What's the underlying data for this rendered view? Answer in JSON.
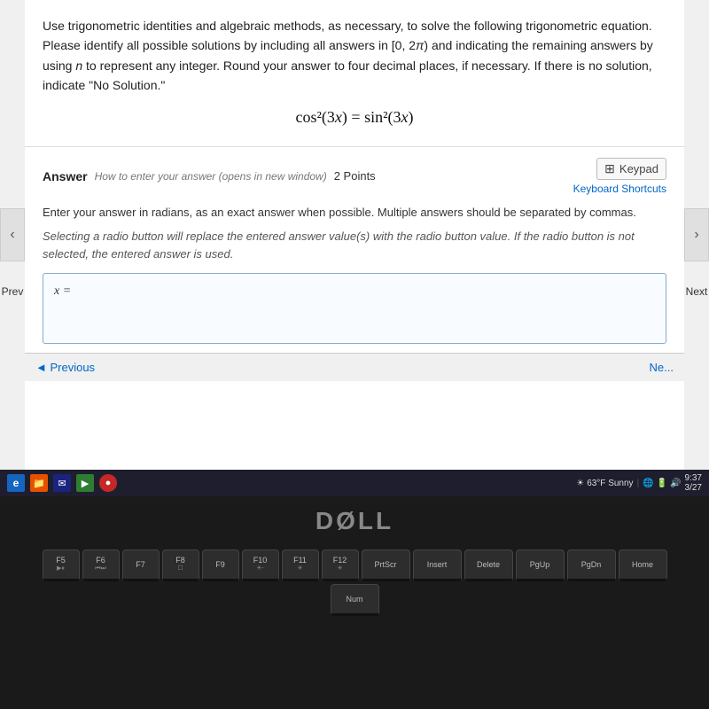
{
  "question": {
    "instructions": "Use trigonometric identities and algebraic methods, as necessary, to solve the following trigonometric equation. Please identify all possible solutions by including all answers in [0, 2π) and indicating the remaining answers by using n to represent any integer. Round your answer to four decimal places, if necessary. If there is no solution, indicate \"No Solution.\"",
    "equation_display": "cos²(3x) = sin²(3x)",
    "equation_lhs": "cos²(3x)",
    "equation_rhs": "sin²(3x)"
  },
  "answer_section": {
    "answer_label": "Answer",
    "how_to_enter_label": "How to enter your answer (opens in new window)",
    "points": "2 Points",
    "keypad_label": "Keypad",
    "keyboard_shortcuts_label": "Keyboard Shortcuts",
    "radians_instructions": "Enter your answer in radians, as an exact answer when possible. Multiple answers should be separated by commas.",
    "radio_instructions": "Selecting a radio button will replace the entered answer value(s) with the radio button value. If the radio button is not selected, the entered answer is used.",
    "input_label": "x ="
  },
  "navigation": {
    "prev_label": "◄ Previous",
    "next_label": "Next ►",
    "nav_left_symbol": "‹",
    "nav_right_symbol": "›",
    "prev_text": "Prev",
    "next_text": "Next"
  },
  "taskbar": {
    "weather": "63°F Sunny",
    "time": "9:37",
    "date": "3/27"
  },
  "dell_logo": "DØLL",
  "keyboard": {
    "function_row": [
      "F5",
      "F6",
      "F7",
      "F8",
      "F9",
      "F10",
      "F11",
      "F12",
      "PrtScr",
      "Insert",
      "Delete",
      "PgUp",
      "PgDn",
      "Home"
    ],
    "num_label": "Num"
  }
}
